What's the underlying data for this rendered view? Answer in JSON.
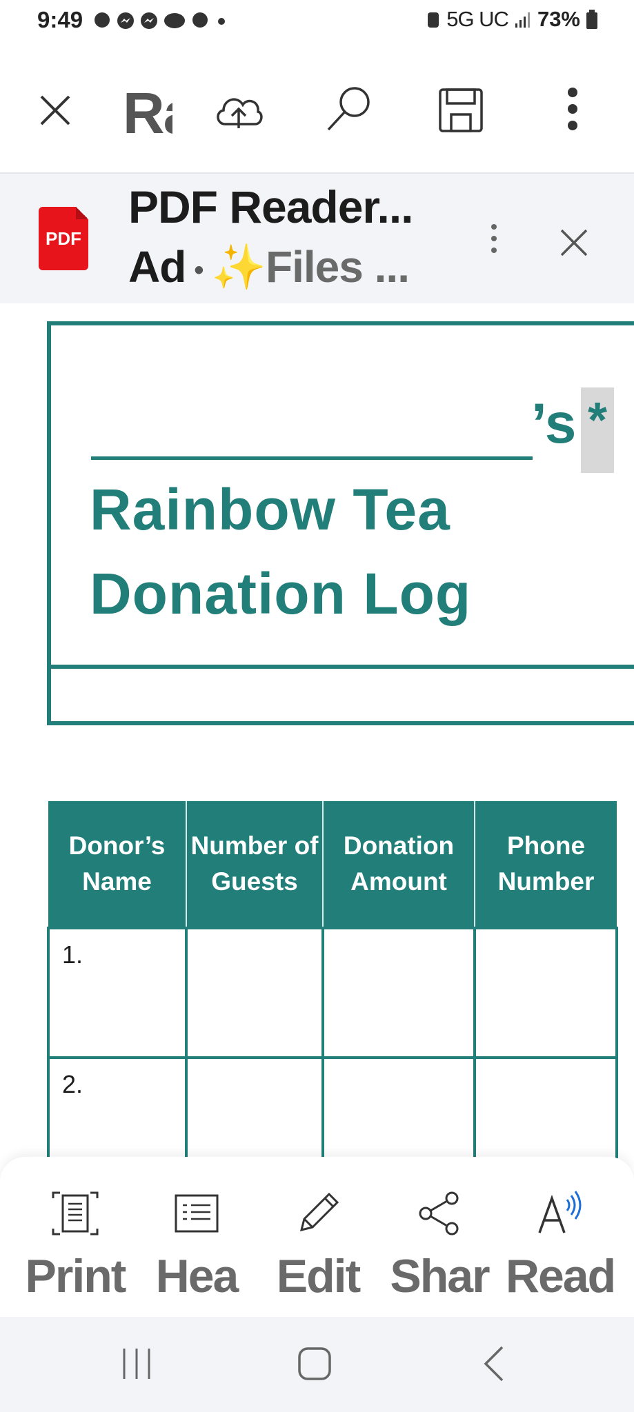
{
  "status_bar": {
    "time": "9:49",
    "network": "5G UC",
    "battery": "73%"
  },
  "toolbar": {
    "doc_title": "Rainbow Tea Donation Log",
    "icons": [
      "close-icon",
      "cloud-upload-icon",
      "search-icon",
      "save-icon",
      "more-vert-icon"
    ]
  },
  "ad": {
    "logo_text": "PDF",
    "title": "PDF Reader...",
    "tag": "Ad",
    "dot": "•",
    "sparkle": "✨",
    "subtitle": "Files ..."
  },
  "document": {
    "possessive": "’s",
    "asterisk": "*",
    "title_line1": "Rainbow Tea",
    "title_line2": "Donation Log",
    "accent_color": "#217e79",
    "table": {
      "headers": [
        "Donor’s Name",
        "Number of Guests",
        "Donation Amount",
        "Phone Number"
      ],
      "rows": [
        "1.",
        "2."
      ]
    }
  },
  "actions": [
    {
      "label": "Print",
      "icon": "print-icon"
    },
    {
      "label": "Hea",
      "icon": "headings-icon"
    },
    {
      "label": "Edit",
      "icon": "edit-pencil-icon"
    },
    {
      "label": "Shar",
      "icon": "share-icon"
    },
    {
      "label": "Read",
      "icon": "read-aloud-icon"
    }
  ],
  "nav": [
    "recent-apps-icon",
    "home-icon",
    "back-icon"
  ]
}
